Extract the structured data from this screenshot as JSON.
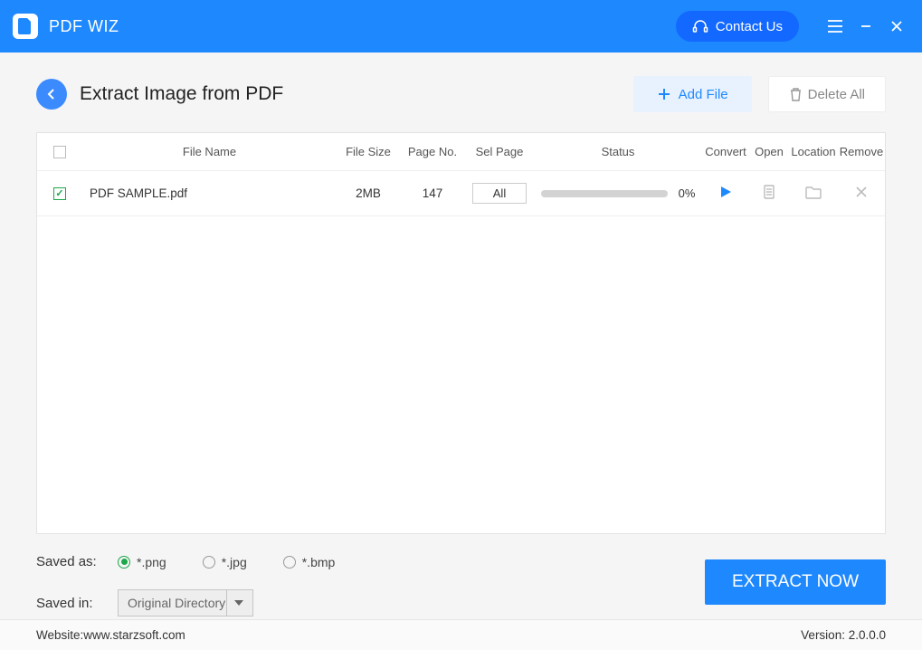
{
  "app": {
    "title": "PDF WIZ",
    "contact": "Contact Us"
  },
  "page": {
    "title": "Extract Image from PDF",
    "add_file": "Add File",
    "delete_all": "Delete All"
  },
  "headers": {
    "name": "File Name",
    "size": "File Size",
    "pageno": "Page No.",
    "selpage": "Sel Page",
    "status": "Status",
    "convert": "Convert",
    "open": "Open",
    "location": "Location",
    "remove": "Remove"
  },
  "rows": [
    {
      "checked": true,
      "name": "PDF SAMPLE.pdf",
      "size": "2MB",
      "pageno": "147",
      "selpage": "All",
      "progress": 0,
      "pct": "0%"
    }
  ],
  "saved_as": {
    "label": "Saved as:",
    "options": [
      "*.png",
      "*.jpg",
      "*.bmp"
    ],
    "selected": "*.png"
  },
  "saved_in": {
    "label": "Saved in:",
    "value": "Original Directory"
  },
  "extract": "EXTRACT NOW",
  "footer": {
    "website_label": "Website: ",
    "website": "www.starzsoft.com",
    "version_label": "Version:  ",
    "version": "2.0.0.0"
  }
}
